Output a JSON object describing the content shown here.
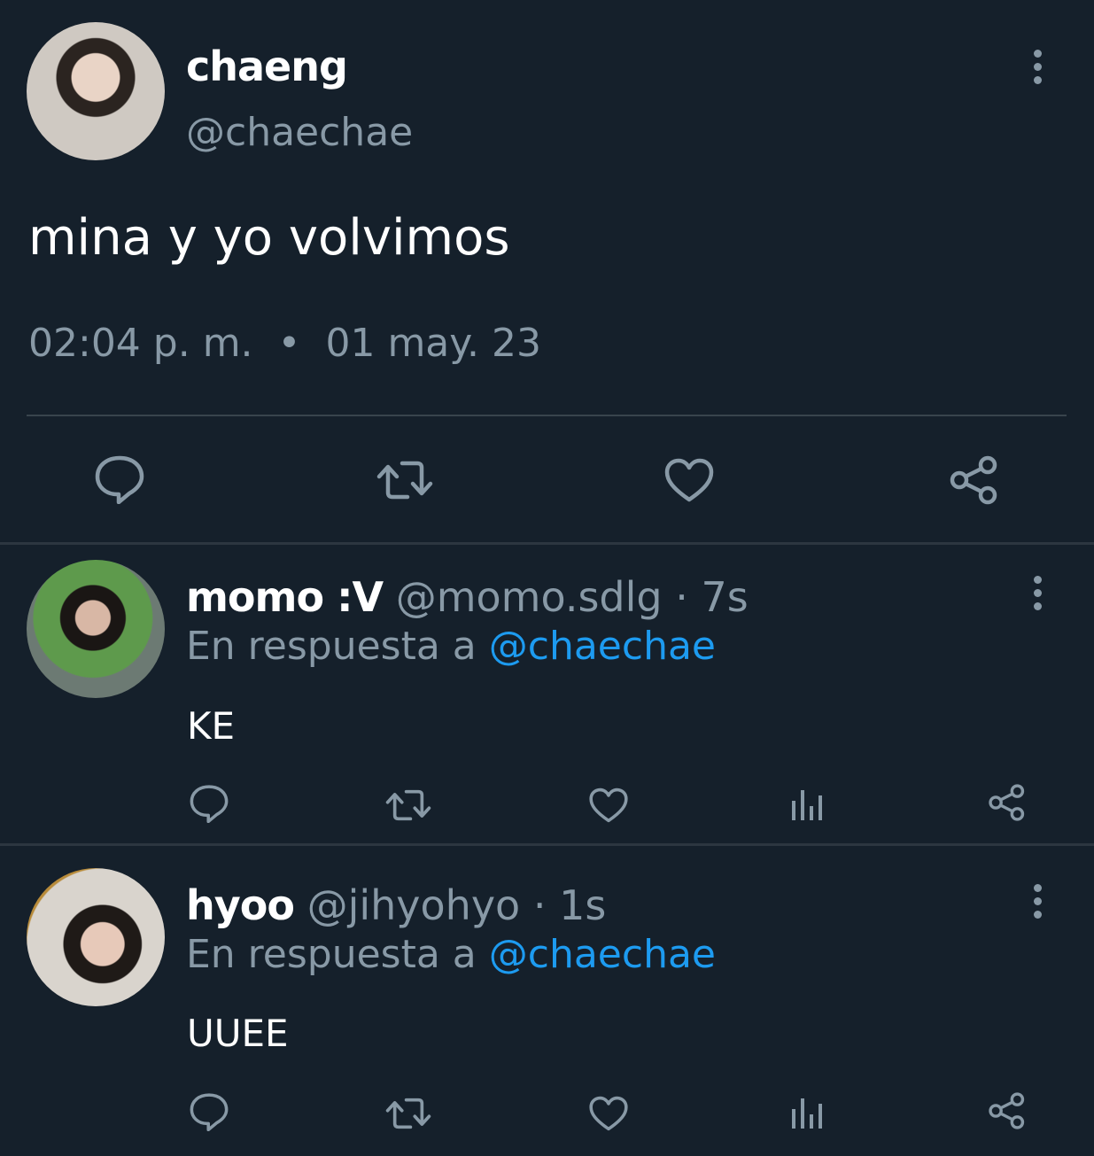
{
  "main_tweet": {
    "display_name": "chaeng",
    "handle": "@chaechae",
    "text": "mina y yo volvimos",
    "time": "02:04 p. m.",
    "separator": "•",
    "date": "01 may. 23",
    "actions": [
      "reply-icon",
      "retweet-icon",
      "like-icon",
      "share-icon"
    ]
  },
  "replies": [
    {
      "display_name": "momo :V",
      "handle": "@momo.sdlg",
      "separator": "·",
      "time": "7s",
      "reply_prefix": "En respuesta a",
      "reply_to": "@chaechae",
      "text": "KE",
      "actions": [
        "reply-icon",
        "retweet-icon",
        "like-icon",
        "analytics-icon",
        "share-icon"
      ]
    },
    {
      "display_name": "hyoo",
      "handle": "@jihyohyo",
      "separator": "·",
      "time": "1s",
      "reply_prefix": "En respuesta a",
      "reply_to": "@chaechae",
      "text": "UUEE",
      "actions": [
        "reply-icon",
        "retweet-icon",
        "like-icon",
        "analytics-icon",
        "share-icon"
      ]
    }
  ],
  "colors": {
    "background": "#15202b",
    "secondary_text": "#8899a6",
    "link": "#1d9bf0",
    "divider": "#38444d"
  }
}
